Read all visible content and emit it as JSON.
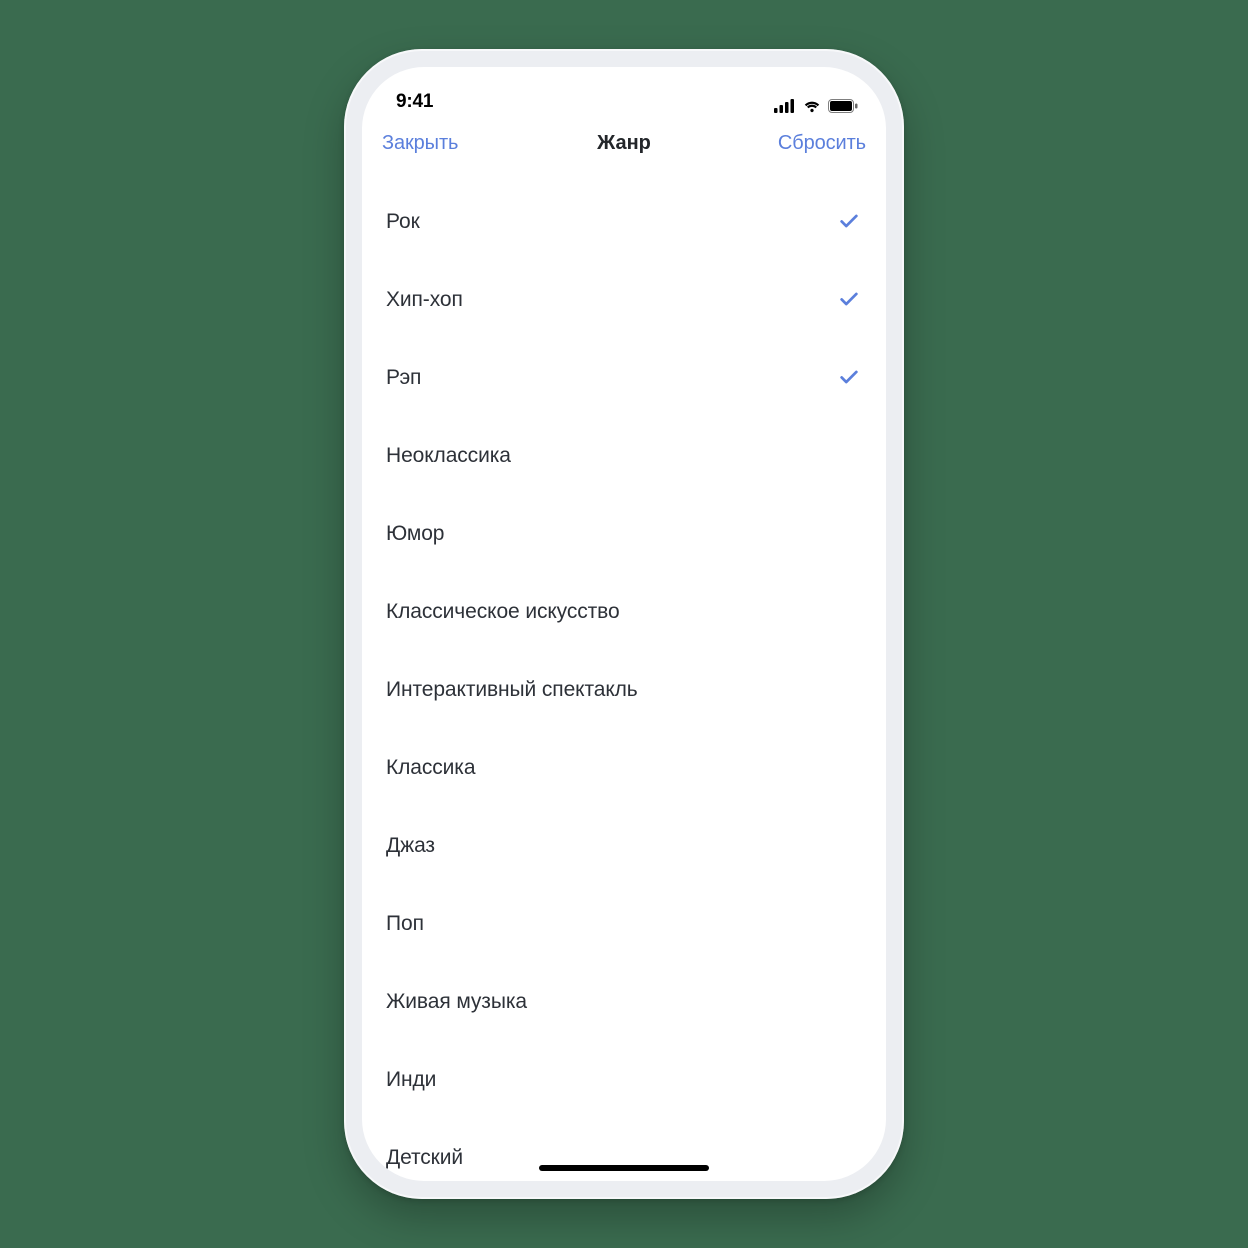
{
  "status": {
    "time": "9:41"
  },
  "nav": {
    "close": "Закрыть",
    "title": "Жанр",
    "reset": "Сбросить"
  },
  "genres": [
    {
      "label": "Рок",
      "selected": true
    },
    {
      "label": "Хип-хоп",
      "selected": true
    },
    {
      "label": "Рэп",
      "selected": true
    },
    {
      "label": "Неоклассика",
      "selected": false
    },
    {
      "label": "Юмор",
      "selected": false
    },
    {
      "label": "Классическое искусство",
      "selected": false
    },
    {
      "label": "Интерактивный спектакль",
      "selected": false
    },
    {
      "label": "Классика",
      "selected": false
    },
    {
      "label": "Джаз",
      "selected": false
    },
    {
      "label": "Поп",
      "selected": false
    },
    {
      "label": "Живая музыка",
      "selected": false
    },
    {
      "label": "Инди",
      "selected": false
    },
    {
      "label": "Детский",
      "selected": false
    }
  ],
  "colors": {
    "accent": "#5b7fdc"
  }
}
